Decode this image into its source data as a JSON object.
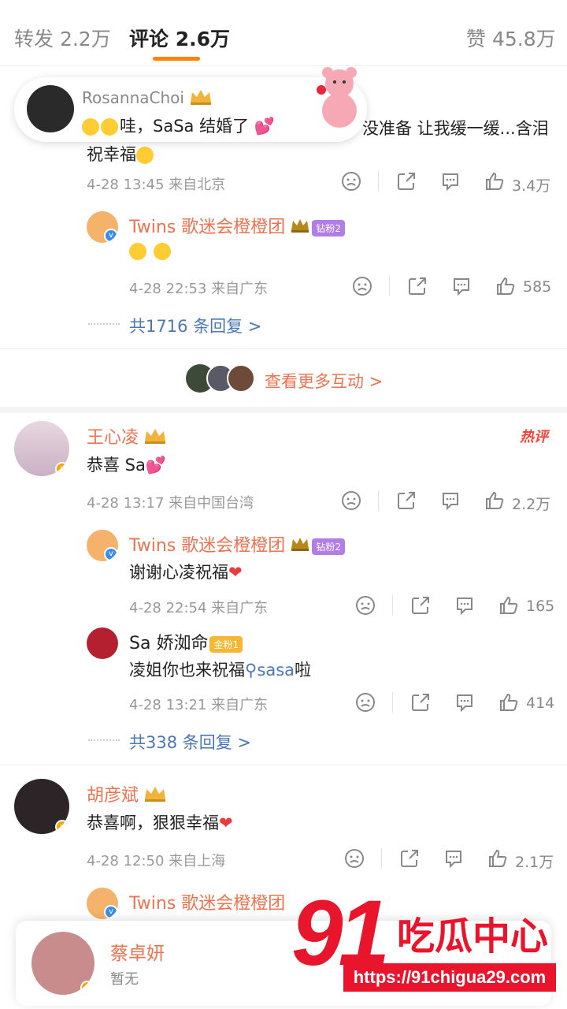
{
  "tabs": {
    "repost": "转发 2.2万",
    "comment": "评论 2.6万",
    "like": "赞 45.8万"
  },
  "toast": {
    "name": "RosannaChoi",
    "text": "哇，SaSa 结婚了"
  },
  "top_comment": {
    "text_line1": "没准备 让我缓一缓...含泪",
    "text_line2": "祝幸福",
    "meta": "4-28 13:45 来自北京",
    "likes": "3.4万",
    "replies": [
      {
        "name": "Twins 歌迷会橙橙团",
        "badge": "钻粉2",
        "text": "",
        "meta": "4-28 22:53 来自广东",
        "likes": "585"
      }
    ],
    "more": "共1716 条回复 >"
  },
  "interactions": "查看更多互动 >",
  "comment2": {
    "name": "王心凌",
    "hot": "热评",
    "text": "恭喜 Sa",
    "meta": "4-28 13:17 来自中国台湾",
    "likes": "2.2万",
    "replies": [
      {
        "name": "Twins 歌迷会橙橙团",
        "badge": "钻粉2",
        "text": "谢谢心凌祝福",
        "meta": "4-28 22:54 来自广东",
        "likes": "165"
      },
      {
        "name": "Sa 娇洳命",
        "badge": "金粉1",
        "text_a": "凌姐你也来祝福",
        "text_link": "sasa",
        "text_b": "啦",
        "meta": "4-28 13:21 来自广东",
        "likes": "414"
      }
    ],
    "more": "共338 条回复 >"
  },
  "comment3": {
    "name": "胡彦斌",
    "text": "恭喜啊，狠狠幸福",
    "meta": "4-28 12:50 来自上海",
    "likes": "2.1万",
    "reply_name": "Twins 歌迷会橙橙团"
  },
  "bottom_card": {
    "name": "蔡卓妍",
    "sub": "暂无"
  },
  "watermark": {
    "number": "91",
    "cn": "吃瓜中心",
    "url": "https://91chigua29.com"
  },
  "colors": {
    "accent": "#ff8200",
    "name": "#eb7350",
    "link": "#4a78b5",
    "watermark": "#e8152d"
  }
}
